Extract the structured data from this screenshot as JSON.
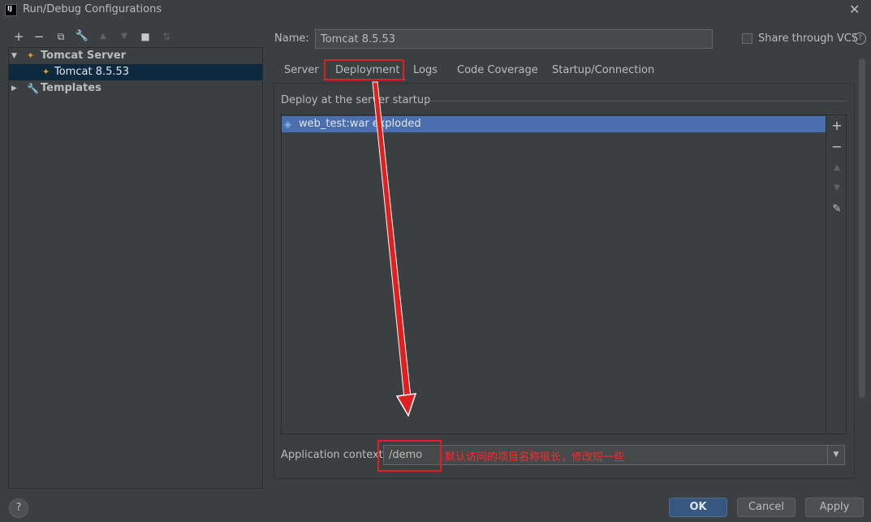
{
  "window": {
    "title": "Run/Debug Configurations",
    "logo_text": "IJ"
  },
  "toolbar": {
    "icons": [
      "add-icon",
      "remove-icon",
      "copy-icon",
      "wrench-icon",
      "move-up-icon",
      "move-down-icon",
      "folder-icon",
      "sort-icon"
    ]
  },
  "tree": {
    "tomcat_server": "Tomcat Server",
    "tomcat_item": "Tomcat 8.5.53",
    "templates": "Templates"
  },
  "name_field": {
    "label": "Name:",
    "value": "Tomcat 8.5.53"
  },
  "share": {
    "label": "Share through VCS",
    "checked": false
  },
  "tabs": [
    "Server",
    "Deployment",
    "Logs",
    "Code Coverage",
    "Startup/Connection"
  ],
  "active_tab": "Deployment",
  "deploy": {
    "heading": "Deploy at the server startup",
    "items": [
      "web_test:war exploded"
    ]
  },
  "context": {
    "label": "Application context:",
    "value": "/demo"
  },
  "annotation": "默认访问的项目名称很长，修改短一些",
  "buttons": {
    "ok": "OK",
    "cancel": "Cancel",
    "apply": "Apply",
    "help": "?"
  },
  "colors": {
    "accent": "#4a88c7",
    "selection": "#4b6eaf",
    "annotation_red": "#e02020",
    "ok_blue": "#365880"
  }
}
